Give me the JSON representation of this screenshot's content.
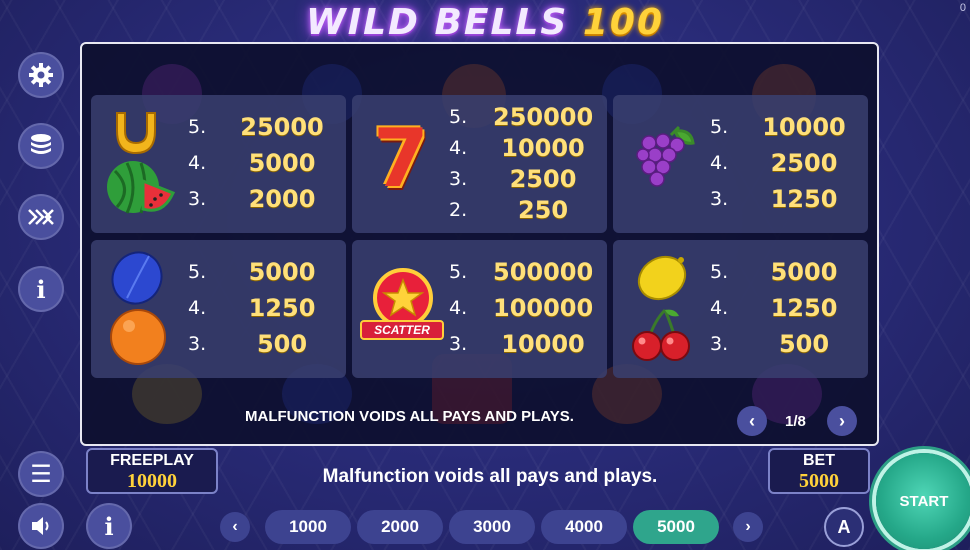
{
  "game_title": {
    "main": "WILD BELLS",
    "number": "100"
  },
  "corner_value": "0",
  "sidebar": [
    {
      "icon": "gear-icon",
      "glyph": "⚙"
    },
    {
      "icon": "coins-stack-icon",
      "glyph": "☰"
    },
    {
      "icon": "volatility-icon",
      "glyph": "✕"
    },
    {
      "icon": "info-icon",
      "glyph": "i"
    }
  ],
  "paytable": {
    "cards": [
      {
        "symbols": [
          "horseshoe",
          "watermelon"
        ],
        "rows": [
          {
            "count": "5.",
            "value": "25000"
          },
          {
            "count": "4.",
            "value": "5000"
          },
          {
            "count": "3.",
            "value": "2000"
          }
        ]
      },
      {
        "symbols": [
          "seven"
        ],
        "symbol_text": "7",
        "rows": [
          {
            "count": "5.",
            "value": "250000"
          },
          {
            "count": "4.",
            "value": "10000"
          },
          {
            "count": "3.",
            "value": "2500"
          },
          {
            "count": "2.",
            "value": "250"
          }
        ]
      },
      {
        "symbols": [
          "grapes"
        ],
        "rows": [
          {
            "count": "5.",
            "value": "10000"
          },
          {
            "count": "4.",
            "value": "2500"
          },
          {
            "count": "3.",
            "value": "1250"
          }
        ]
      },
      {
        "symbols": [
          "plum",
          "orange"
        ],
        "rows": [
          {
            "count": "5.",
            "value": "5000"
          },
          {
            "count": "4.",
            "value": "1250"
          },
          {
            "count": "3.",
            "value": "500"
          }
        ]
      },
      {
        "symbols": [
          "scatter-star"
        ],
        "symbol_text": "SCATTER",
        "rows": [
          {
            "count": "5.",
            "value": "500000"
          },
          {
            "count": "4.",
            "value": "100000"
          },
          {
            "count": "3.",
            "value": "10000"
          }
        ]
      },
      {
        "symbols": [
          "lemon",
          "cherries"
        ],
        "rows": [
          {
            "count": "5.",
            "value": "5000"
          },
          {
            "count": "4.",
            "value": "1250"
          },
          {
            "count": "3.",
            "value": "500"
          }
        ]
      }
    ],
    "notice": "MALFUNCTION VOIDS ALL PAYS AND PLAYS.",
    "page": "1/8",
    "prev_glyph": "‹",
    "next_glyph": "›"
  },
  "freeplay": {
    "label": "FREEPLAY",
    "value": "10000"
  },
  "bet": {
    "label": "BET",
    "value": "5000"
  },
  "bottom_notice": "Malfunction voids all pays and plays.",
  "menu_glyph": "☰",
  "sound_glyph": "◀",
  "info_glyph": "i",
  "bet_options": [
    {
      "label": "1000",
      "active": false
    },
    {
      "label": "2000",
      "active": false
    },
    {
      "label": "3000",
      "active": false
    },
    {
      "label": "4000",
      "active": false
    },
    {
      "label": "5000",
      "active": true
    }
  ],
  "bet_prev_glyph": "‹",
  "bet_next_glyph": "›",
  "auto_label": "A",
  "start_label": "START",
  "colors": {
    "value_gold": "#ffe07a",
    "active_pill": "#2fa58c",
    "start": "#25a889"
  }
}
